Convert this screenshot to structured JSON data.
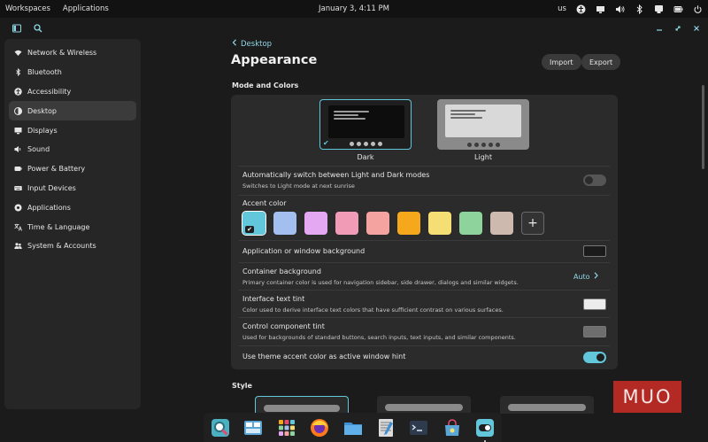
{
  "top_panel": {
    "workspaces": "Workspaces",
    "applications": "Applications",
    "clock": "January 3, 4:11 PM",
    "keyboard_layout": "us",
    "tray_icons": [
      "accessibility-icon",
      "display-icon",
      "volume-icon",
      "bluetooth-icon",
      "network-icon",
      "battery-icon",
      "power-icon"
    ]
  },
  "header": {
    "icons": [
      "sidebar-toggle-icon",
      "search-icon"
    ],
    "window_controls": [
      "minimize-icon",
      "maximize-icon",
      "close-icon"
    ]
  },
  "sidebar": {
    "items": [
      {
        "label": "Network & Wireless",
        "icon": "wifi-icon",
        "active": false
      },
      {
        "label": "Bluetooth",
        "icon": "bluetooth-icon",
        "active": false
      },
      {
        "label": "Accessibility",
        "icon": "accessibility-icon",
        "active": false
      },
      {
        "label": "Desktop",
        "icon": "desktop-icon",
        "active": true
      },
      {
        "label": "Displays",
        "icon": "display-icon",
        "active": false
      },
      {
        "label": "Sound",
        "icon": "speaker-icon",
        "active": false
      },
      {
        "label": "Power & Battery",
        "icon": "battery-icon",
        "active": false
      },
      {
        "label": "Input Devices",
        "icon": "keyboard-icon",
        "active": false
      },
      {
        "label": "Applications",
        "icon": "apps-icon",
        "active": false
      },
      {
        "label": "Time & Language",
        "icon": "clock-icon",
        "active": false
      },
      {
        "label": "System & Accounts",
        "icon": "users-icon",
        "active": false
      }
    ]
  },
  "main": {
    "back_label": "Desktop",
    "title": "Appearance",
    "import_label": "Import",
    "export_label": "Export",
    "mode_section": "Mode and Colors",
    "theme_dark_label": "Dark",
    "theme_light_label": "Light",
    "auto_switch": {
      "title": "Automatically switch between Light and Dark modes",
      "desc": "Switches to Light mode at next sunrise",
      "enabled": false
    },
    "accent": {
      "title": "Accent color",
      "swatches": [
        "#63c7dc",
        "#a3bff0",
        "#e4a8f2",
        "#f29bb7",
        "#f4a3a0",
        "#f5a81c",
        "#f5de74",
        "#8ed39b",
        "#cdb9ae"
      ],
      "selected": 0
    },
    "app_background": {
      "title": "Application or window background",
      "color": "#1b1b1b"
    },
    "container_background": {
      "title": "Container background",
      "desc": "Primary container color is used for navigation sidebar, side drawer, dialogs and similar widgets.",
      "value": "Auto"
    },
    "text_tint": {
      "title": "Interface text tint",
      "desc": "Color used to derive interface text colors that have sufficient contrast on various surfaces.",
      "color": "#ececec"
    },
    "control_tint": {
      "title": "Control component tint",
      "desc": "Used for backgrounds of standard buttons, search inputs, text inputs, and similar components.",
      "color": "#6e6e6e"
    },
    "window_hint": {
      "title": "Use theme accent color as active window hint",
      "enabled": true
    },
    "style_section": "Style"
  },
  "watermark": "MUO",
  "dock": {
    "apps": [
      "search-icon",
      "workspaces-icon",
      "app-library-icon",
      "firefox-icon",
      "files-icon",
      "text-editor-icon",
      "terminal-icon",
      "store-icon",
      "settings-icon"
    ]
  },
  "colors": {
    "accent": "#63c7dc",
    "background": "#1b1b1b",
    "card": "#2b2b2b"
  }
}
